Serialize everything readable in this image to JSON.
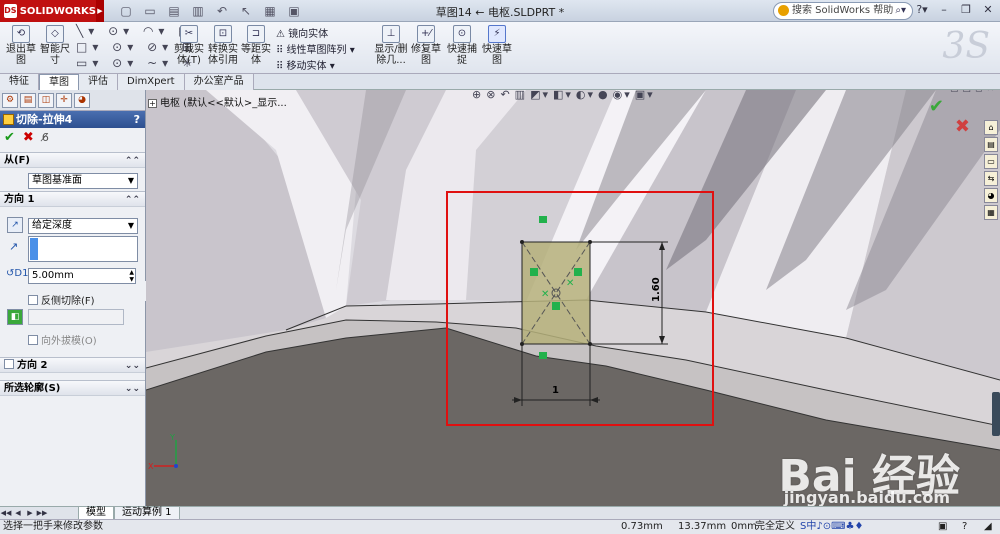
{
  "app": {
    "name": "SOLIDWORKS",
    "document_title": "草图14 ← 电枢.SLDPRT *"
  },
  "search": {
    "placeholder": "搜索 SolidWorks 帮助"
  },
  "command_manager": {
    "exit_sketch": "退出草图",
    "smart_dimension": "智能尺寸",
    "trim_entities": "剪裁实体(T)",
    "convert_entities": "转换实体引用",
    "offset_entities": "等距实体",
    "mirror_entities": "镜向实体",
    "linear_pattern": "线性草图阵列",
    "move_entities": "移动实体",
    "display_delete_relations": "显示/删除几...",
    "repair_sketch": "修复草图",
    "quick_snaps": "快速捕捉",
    "rapid_sketch": "快速草图"
  },
  "tabs": [
    "特征",
    "草图",
    "评估",
    "DimXpert",
    "办公室产品"
  ],
  "active_tab": "草图",
  "property_manager": {
    "title": "切除-拉伸4",
    "help": "?",
    "from_group": {
      "label": "从(F)",
      "value": "草图基准面"
    },
    "direction1_group": {
      "label": "方向 1",
      "end_condition": "给定深度",
      "depth": "5.00mm",
      "flip_side_to_cut": "反侧切除(F)",
      "draft_outward": "向外拔模(O)"
    },
    "direction2_group": {
      "label": "方向 2"
    },
    "selected_contours_group": {
      "label": "所选轮廓(S)"
    }
  },
  "viewport": {
    "tree_item": "电枢  (默认<<默认>_显示...",
    "dimension_width": "1",
    "dimension_height": "1.60",
    "watermark_brand": "Bai 经验",
    "watermark_url": "jingyan.baidu.com"
  },
  "bottom_tabs": [
    "模型",
    "运动算例 1"
  ],
  "status_bar": {
    "message": "选择一把手来修改参数",
    "x": "0.73mm",
    "y": "13.37mm",
    "z": "0mm",
    "state": "完全定义"
  },
  "colors": {
    "highlight_box": "#e01010",
    "sketch_fill": "#b5b07a",
    "relation_green": "#22b14c",
    "title_blue": "#2d4f8f"
  }
}
